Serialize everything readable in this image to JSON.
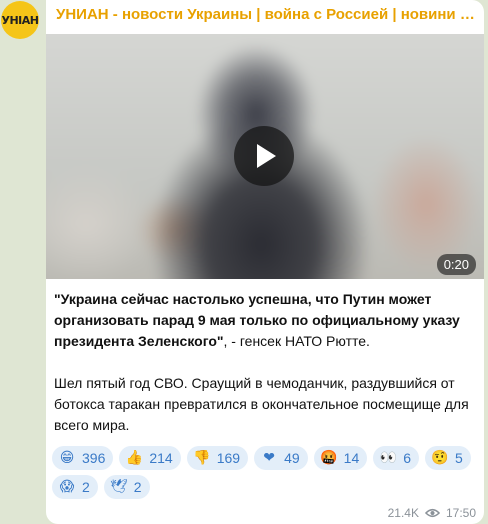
{
  "channel": {
    "avatar_text": "УНIАН",
    "title": "УНИАН - новости Украины | война с Россией | новини України..."
  },
  "video": {
    "duration": "0:20"
  },
  "post": {
    "quote_bold": "\"Украина сейчас настолько успешна, что Путин может организовать парад 9 мая только по официальному указу президента Зеленского\"",
    "quote_rest": ", - генсек НАТО Рютте.",
    "comment": "Шел пятый год СВО. Сраущий в чемоданчик, раздувшийся от ботокса таракан превратился в окончательное посмещище для всего мира."
  },
  "reactions": [
    {
      "emoji": "😁",
      "count": "396",
      "bg": "#f5c518"
    },
    {
      "emoji": "👍",
      "count": "214",
      "bg": "#f5c518"
    },
    {
      "emoji": "👎",
      "count": "169",
      "bg": "#f5c518"
    },
    {
      "emoji": "❤",
      "count": "49",
      "bg": "#e53935"
    },
    {
      "emoji": "🤬",
      "count": "14",
      "bg": "#d84315"
    },
    {
      "emoji": "👀",
      "count": "6",
      "bg": "#ffffff"
    },
    {
      "emoji": "🤨",
      "count": "5",
      "bg": "#f5c518"
    },
    {
      "emoji": "😱",
      "count": "2",
      "bg": "#f5c518"
    },
    {
      "emoji": "🕊",
      "count": "2",
      "bg": "#ffffff"
    }
  ],
  "meta": {
    "views": "21.4K",
    "time": "17:50"
  },
  "colors": {
    "accent": "#e8a100",
    "reaction_bg": "#e3eef9",
    "reaction_text": "#3a7ac7"
  }
}
